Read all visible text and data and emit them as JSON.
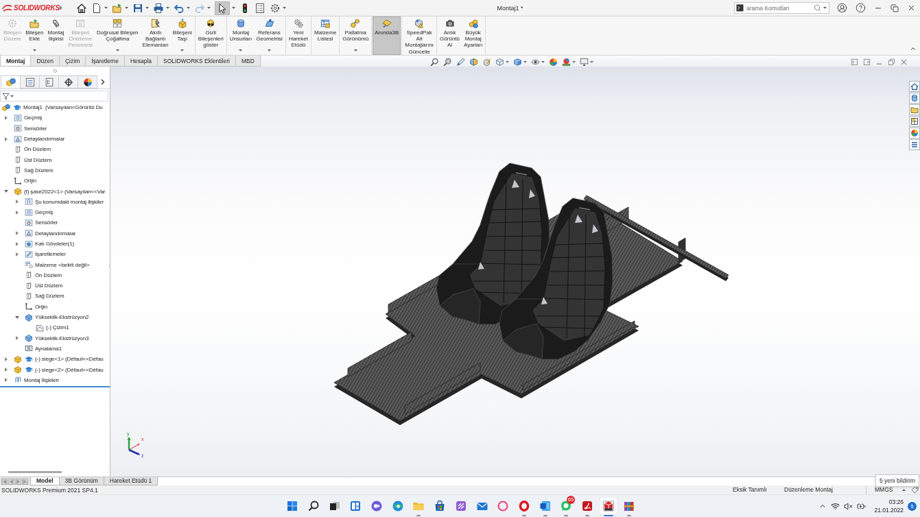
{
  "title_bar": {
    "logo": "SOLIDWORKS",
    "title": "Montaj1 *",
    "search": {
      "placeholder": "arama Komutları"
    }
  },
  "quick_access_toolbar": [
    {
      "disabled": false,
      "pressed": false
    },
    {
      "disabled": false,
      "pressed": false
    },
    {
      "disabled": false,
      "pressed": false
    },
    {
      "disabled": false,
      "pressed": false
    },
    {
      "disabled": false,
      "pressed": false
    },
    {
      "disabled": false,
      "pressed": false
    },
    {
      "disabled": true,
      "pressed": false
    },
    {
      "disabled": false,
      "pressed": true
    },
    {
      "disabled": false,
      "pressed": false
    },
    {
      "disabled": false,
      "pressed": false
    },
    {
      "disabled": false,
      "pressed": false
    }
  ],
  "ribbon": {
    "groups": [
      [
        {
          "label_lines": [
            "Bileşen",
            "Düzele"
          ],
          "disabled": true,
          "pressed": false,
          "dropdown": false
        },
        {
          "label_lines": [
            "Bileşen",
            "Ekle"
          ],
          "disabled": false,
          "pressed": false,
          "dropdown": true
        },
        {
          "label_lines": [
            "Montaj",
            "İlişkisi"
          ],
          "disabled": false,
          "pressed": false,
          "dropdown": false
        },
        {
          "label_lines": [
            "Bileşen",
            "Önizleme",
            "Penceresi"
          ],
          "disabled": true,
          "pressed": false,
          "dropdown": false
        },
        {
          "label_lines": [
            "Doğrusal Bileşen",
            "Çoğaltma"
          ],
          "disabled": false,
          "pressed": false,
          "dropdown": true
        },
        {
          "label_lines": [
            "Akıllı",
            "Bağlantı",
            "Elemanları"
          ],
          "disabled": false,
          "pressed": false,
          "dropdown": false
        },
        {
          "label_lines": [
            "Bileşeni",
            "Taşı"
          ],
          "disabled": false,
          "pressed": false,
          "dropdown": true
        }
      ],
      [
        {
          "label_lines": [
            "Gizli",
            "Bileşenleri",
            "göster"
          ],
          "disabled": false,
          "pressed": false,
          "dropdown": false
        }
      ],
      [
        {
          "label_lines": [
            "Montaj",
            "Unsurları"
          ],
          "disabled": false,
          "pressed": false,
          "dropdown": true
        },
        {
          "label_lines": [
            "Referans",
            "Geometrisi"
          ],
          "disabled": false,
          "pressed": false,
          "dropdown": true
        }
      ],
      [
        {
          "label_lines": [
            "Yeni",
            "Hareket",
            "Etüdü"
          ],
          "disabled": false,
          "pressed": false,
          "dropdown": false
        }
      ],
      [
        {
          "label_lines": [
            "Malzeme",
            "Listesi"
          ],
          "disabled": false,
          "pressed": false,
          "dropdown": false
        }
      ],
      [
        {
          "label_lines": [
            "Patlatma",
            "Görünümü"
          ],
          "disabled": false,
          "pressed": false,
          "dropdown": true
        }
      ],
      [
        {
          "label_lines": [
            "Anında3B"
          ],
          "disabled": false,
          "pressed": true,
          "dropdown": false
        }
      ],
      [
        {
          "label_lines": [
            "SpeedPak",
            "Alt",
            "Montajlarını",
            "Güncelle"
          ],
          "disabled": false,
          "pressed": false,
          "dropdown": false
        }
      ],
      [
        {
          "label_lines": [
            "Anlık",
            "Görüntü",
            "Al"
          ],
          "disabled": false,
          "pressed": false,
          "dropdown": false
        },
        {
          "label_lines": [
            "Büyük",
            "Montaj",
            "Ayarları"
          ],
          "disabled": false,
          "pressed": false,
          "dropdown": false
        }
      ]
    ]
  },
  "command_tabs": [
    {
      "label": "Montaj",
      "selected": true
    },
    {
      "label": "Düzen",
      "selected": false
    },
    {
      "label": "Çizim",
      "selected": false
    },
    {
      "label": "İşaretleme",
      "selected": false
    },
    {
      "label": "Hesapla",
      "selected": false
    },
    {
      "label": "SOLIDWORKS Eklentileri",
      "selected": false
    },
    {
      "label": "MBD",
      "selected": false
    }
  ],
  "feature_manager": {
    "tabs": [
      {
        "selected": true
      },
      {
        "selected": false
      },
      {
        "selected": false
      },
      {
        "selected": false
      },
      {
        "selected": false
      }
    ],
    "tree": [
      {
        "label": "Montaj1  (Varsayılan<Görüntü Du",
        "kind": "assembly",
        "children": [
          {
            "label": "Geçmiş",
            "kind": "history",
            "expanded": false
          },
          {
            "label": "Sensörler",
            "kind": "sensors"
          },
          {
            "label": "Detaylandırmalar",
            "kind": "annotations",
            "expanded": false
          },
          {
            "label": "Ön Düzlem",
            "kind": "plane"
          },
          {
            "label": "Üst Düzlem",
            "kind": "plane"
          },
          {
            "label": "Sağ Düzlem",
            "kind": "plane"
          },
          {
            "label": "Orijin",
            "kind": "origin"
          },
          {
            "label": "(f) şase2022<1> (Varsayılan<<Var",
            "kind": "part",
            "expanded": true,
            "children": [
              {
                "label": "Şu konumdaki montaj ilişkiler",
                "kind": "mates_folder",
                "expanded": false
              },
              {
                "label": "Geçmiş",
                "kind": "history",
                "expanded": false
              },
              {
                "label": "Sensörler",
                "kind": "sensors"
              },
              {
                "label": "Detaylandırmalar",
                "kind": "annotations",
                "expanded": false
              },
              {
                "label": "Katı Gövdeler(1)",
                "kind": "solid_bodies",
                "expanded": false
              },
              {
                "label": "İşaretlemeler",
                "kind": "markups",
                "expanded": false
              },
              {
                "label": "Malzeme <belirli değil>",
                "kind": "material"
              },
              {
                "label": "Ön Düzlem",
                "kind": "plane"
              },
              {
                "label": "Üst Düzlem",
                "kind": "plane"
              },
              {
                "label": "Sağ Düzlem",
                "kind": "plane"
              },
              {
                "label": "Orijin",
                "kind": "origin"
              },
              {
                "label": "Yükseklik-Ekstrüzyon2",
                "kind": "extrude",
                "expanded": true,
                "children": [
                  {
                    "label": "(-) Çizim1",
                    "kind": "sketch"
                  }
                ]
              },
              {
                "label": "Yükseklik-Ekstrüzyon3",
                "kind": "extrude",
                "expanded": false
              },
              {
                "label": "Aynalama1",
                "kind": "mirror"
              }
            ]
          },
          {
            "label": "(-) siege<1> (Défaut<<Défau",
            "kind": "subassembly",
            "expanded": false
          },
          {
            "label": "(-) siege<2> (Défaut<<Défau",
            "kind": "subassembly",
            "expanded": false
          },
          {
            "label": "Montaj İlişkileri",
            "kind": "mates",
            "expanded": false
          }
        ]
      }
    ]
  },
  "graphics_area": {
    "triad_labels": [
      "x",
      "y",
      "z"
    ]
  },
  "document_tabs": [
    {
      "label": "Model",
      "selected": true
    },
    {
      "label": "3B Görünüm",
      "selected": false
    },
    {
      "label": "Hareket Etüdü 1",
      "selected": false
    }
  ],
  "status_bar": {
    "product": "SOLIDWORKS Premium 2021 SP4.1",
    "state": "Eksik Tanımlı",
    "mode": "Düzenleme Montaj",
    "units": "MMGS"
  },
  "notification_tooltip": "5 yeni bildirim",
  "taskbar": {
    "apps": [
      {
        "running": false,
        "active": false
      },
      {
        "running": false,
        "active": false
      },
      {
        "running": false,
        "active": false
      },
      {
        "running": false,
        "active": false
      },
      {
        "running": false,
        "active": false
      },
      {
        "running": false,
        "active": false
      },
      {
        "running": true,
        "active": false
      },
      {
        "running": false,
        "active": false
      },
      {
        "running": false,
        "active": false
      },
      {
        "running": false,
        "active": false
      },
      {
        "running": false,
        "active": false
      },
      {
        "running": true,
        "active": false
      },
      {
        "running": true,
        "active": false
      },
      {
        "running": true,
        "active": false,
        "badge": "65"
      },
      {
        "running": true,
        "active": false
      },
      {
        "running": true,
        "active": true
      },
      {
        "running": true,
        "active": false
      }
    ],
    "tray": {
      "time": "03:26",
      "date": "21.01.2022",
      "notifications": "5"
    }
  }
}
